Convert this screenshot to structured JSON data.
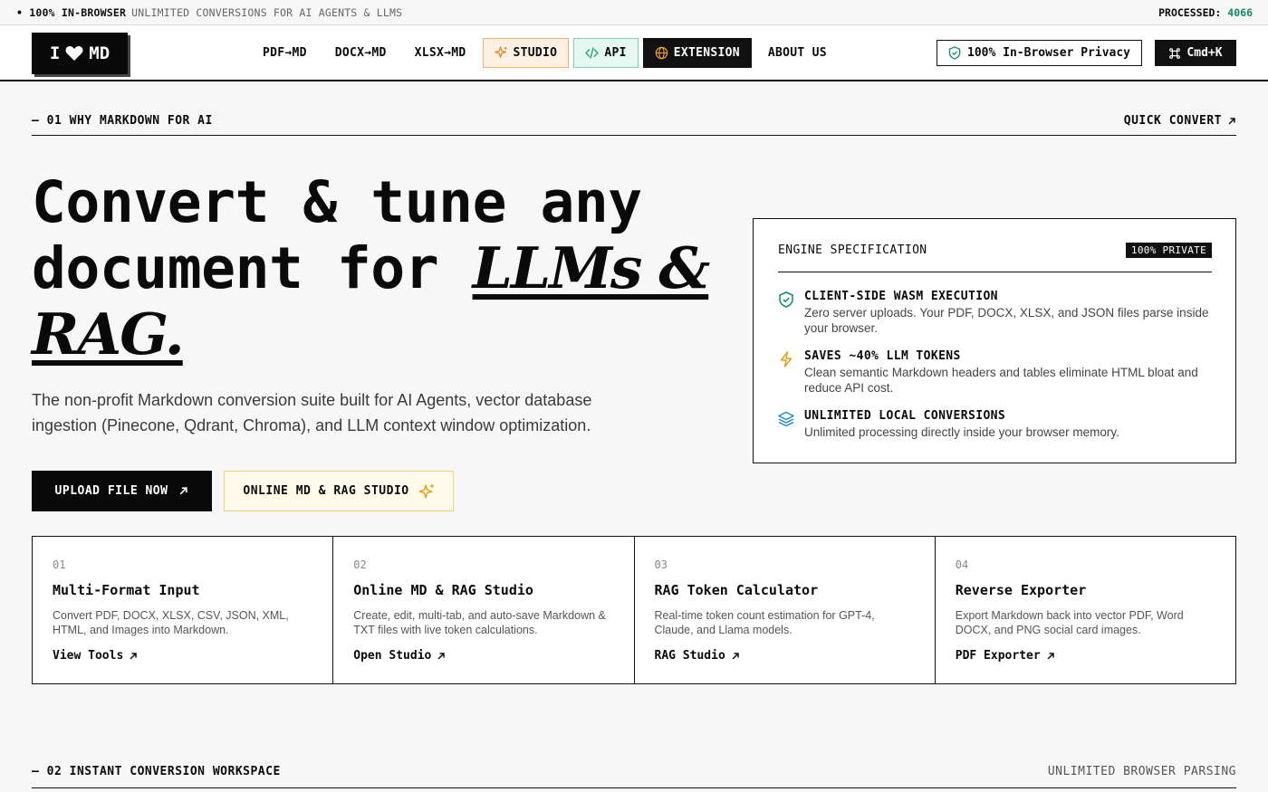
{
  "topbar": {
    "badge": "• 100% IN-BROWSER",
    "tagline": "UNLIMITED CONVERSIONS FOR AI AGENTS & LLMS",
    "processed_label": "PROCESSED:",
    "processed_count": "4066"
  },
  "header": {
    "logo_left": "I",
    "logo_right": "MD",
    "nav": {
      "pdf": "PDF→MD",
      "docx": "DOCX→MD",
      "xlsx": "XLSX→MD",
      "studio": "STUDIO",
      "api": "API",
      "extension": "EXTENSION",
      "about": "ABOUT US"
    },
    "privacy_label": "100% In-Browser Privacy",
    "cmdk_label": "Cmd+K"
  },
  "section1": {
    "label": "— 01 WHY MARKDOWN FOR AI",
    "quick_convert": "QUICK CONVERT"
  },
  "hero": {
    "title_line1": "Convert & tune any",
    "title_line2": "document for ",
    "title_italic1": "LLMs &",
    "title_italic2": "RAG.",
    "description": "The non-profit Markdown conversion suite built for AI Agents, vector database ingestion (Pinecone, Qdrant, Chroma), and LLM context window optimization.",
    "upload_button": "UPLOAD FILE NOW",
    "studio_button": "ONLINE MD & RAG STUDIO"
  },
  "spec": {
    "title": "ENGINE SPECIFICATION",
    "badge": "100% PRIVATE",
    "items": [
      {
        "title": "CLIENT-SIDE WASM EXECUTION",
        "desc": "Zero server uploads. Your PDF, DOCX, XLSX, and JSON files parse inside your browser."
      },
      {
        "title": "SAVES ~40% LLM TOKENS",
        "desc": "Clean semantic Markdown headers and tables eliminate HTML bloat and reduce API cost."
      },
      {
        "title": "UNLIMITED LOCAL CONVERSIONS",
        "desc": "Unlimited processing directly inside your browser memory."
      }
    ]
  },
  "cards": [
    {
      "num": "01",
      "title": "Multi-Format Input",
      "desc": "Convert PDF, DOCX, XLSX, CSV, JSON, XML, HTML, and Images into Markdown.",
      "link": "View Tools"
    },
    {
      "num": "02",
      "title": "Online MD & RAG Studio",
      "desc": "Create, edit, multi-tab, and auto-save Markdown & TXT files with live token calculations.",
      "link": "Open Studio"
    },
    {
      "num": "03",
      "title": "RAG Token Calculator",
      "desc": "Real-time token count estimation for GPT-4, Claude, and Llama models.",
      "link": "RAG Studio"
    },
    {
      "num": "04",
      "title": "Reverse Exporter",
      "desc": "Export Markdown back into vector PDF, Word DOCX, and PNG social card images.",
      "link": "PDF Exporter"
    }
  ],
  "section2": {
    "label": "— 02 INSTANT CONVERSION WORKSPACE",
    "right_label": "UNLIMITED BROWSER PARSING"
  },
  "colors": {
    "accent_green": "#148a63",
    "studio_orange": "#e8862a",
    "api_green": "#2aa37a",
    "spark_gold": "#e0a020",
    "layers_blue": "#1e88c8"
  }
}
